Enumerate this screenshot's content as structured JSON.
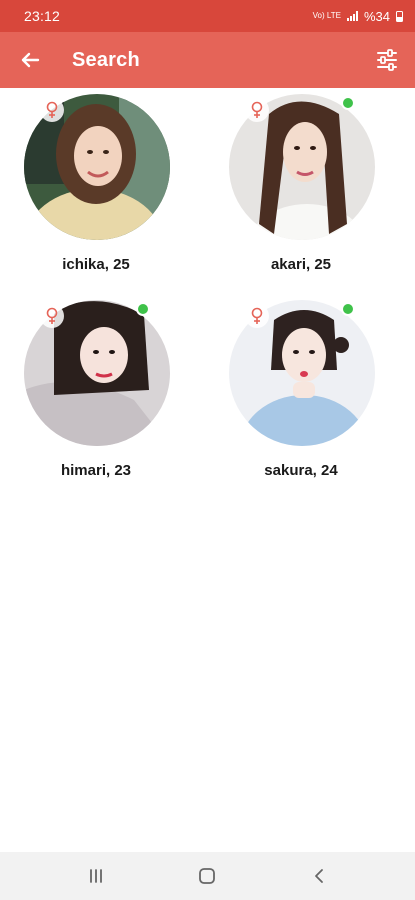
{
  "status_bar": {
    "time": "23:12",
    "network": "Vo) LTE",
    "battery_text": "%34"
  },
  "app_bar": {
    "title": "Search",
    "back_icon": "arrow-left-icon",
    "filter_icon": "sliders-icon"
  },
  "profiles": [
    {
      "label": "ichika, 25",
      "gender": "female",
      "online": false
    },
    {
      "label": "akari, 25",
      "gender": "female",
      "online": true
    },
    {
      "label": "himari, 23",
      "gender": "female",
      "online": true
    },
    {
      "label": "sakura, 24",
      "gender": "female",
      "online": true
    }
  ],
  "nav_bar": {
    "recents_icon": "recents-icon",
    "home_icon": "home-icon",
    "back_icon": "back-icon"
  },
  "colors": {
    "status_bar": "#d8473b",
    "app_bar": "#e56458",
    "online": "#3fc24a",
    "gender_icon": "#e56458"
  }
}
